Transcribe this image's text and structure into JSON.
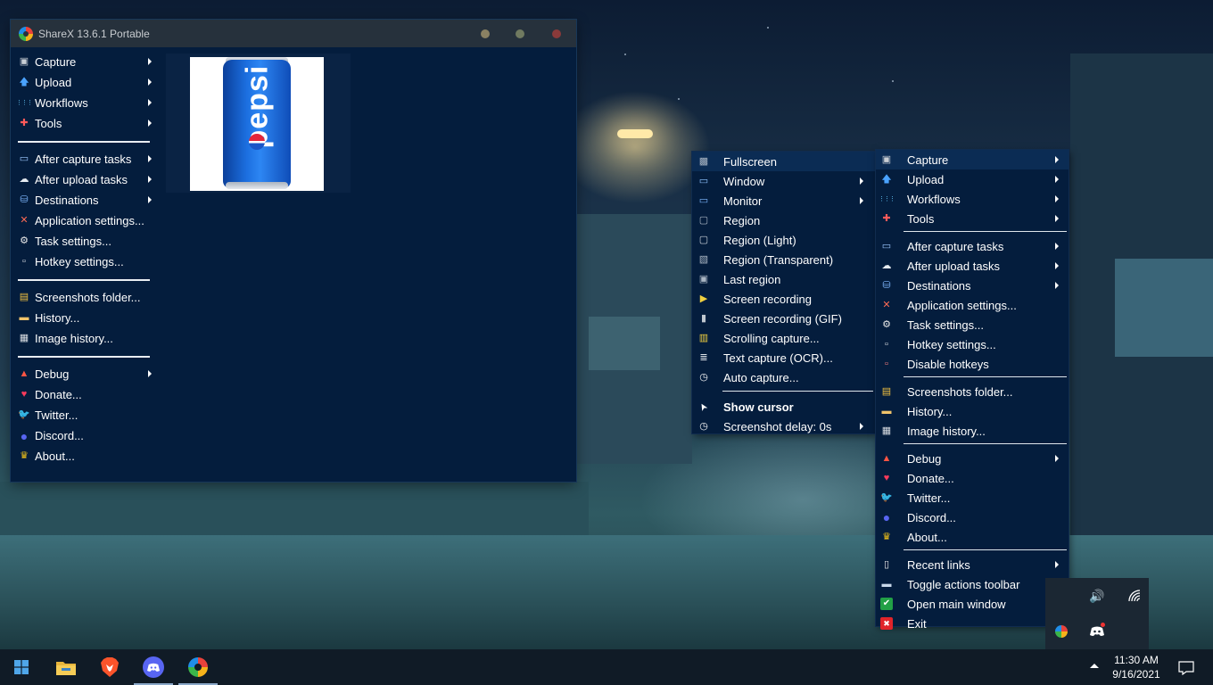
{
  "window": {
    "title": "ShareX 13.6.1 Portable",
    "side_menu": [
      {
        "label": "Capture",
        "icon": "capture-icon",
        "submenu": true
      },
      {
        "label": "Upload",
        "icon": "upload-icon",
        "submenu": true
      },
      {
        "label": "Workflows",
        "icon": "workflows-icon",
        "submenu": true
      },
      {
        "label": "Tools",
        "icon": "tools-icon",
        "submenu": true
      },
      {
        "sep": true
      },
      {
        "label": "After capture tasks",
        "icon": "after-capture-icon",
        "submenu": true
      },
      {
        "label": "After upload tasks",
        "icon": "after-upload-icon",
        "submenu": true
      },
      {
        "label": "Destinations",
        "icon": "destinations-icon",
        "submenu": true
      },
      {
        "label": "Application settings...",
        "icon": "app-settings-icon",
        "submenu": false
      },
      {
        "label": "Task settings...",
        "icon": "gear-icon",
        "submenu": false
      },
      {
        "label": "Hotkey settings...",
        "icon": "hotkey-icon",
        "submenu": false
      },
      {
        "sep": true
      },
      {
        "label": "Screenshots folder...",
        "icon": "folder-icon",
        "submenu": false
      },
      {
        "label": "History...",
        "icon": "history-icon",
        "submenu": false
      },
      {
        "label": "Image history...",
        "icon": "image-history-icon",
        "submenu": false
      },
      {
        "sep": true
      },
      {
        "label": "Debug",
        "icon": "debug-icon",
        "submenu": true
      },
      {
        "label": "Donate...",
        "icon": "heart-icon",
        "submenu": false
      },
      {
        "label": "Twitter...",
        "icon": "twitter-icon",
        "submenu": false
      },
      {
        "label": "Discord...",
        "icon": "discord-icon",
        "submenu": false
      },
      {
        "label": "About...",
        "icon": "crown-icon",
        "submenu": false
      }
    ],
    "preview": {
      "text": "pepsi"
    }
  },
  "capture_submenu": [
    {
      "label": "Fullscreen",
      "icon": "fullscreen-icon",
      "submenu": false,
      "highlight": true
    },
    {
      "label": "Window",
      "icon": "window-icon",
      "submenu": true
    },
    {
      "label": "Monitor",
      "icon": "monitor-icon",
      "submenu": true
    },
    {
      "label": "Region",
      "icon": "region-icon",
      "submenu": false
    },
    {
      "label": "Region (Light)",
      "icon": "region-light-icon",
      "submenu": false
    },
    {
      "label": "Region (Transparent)",
      "icon": "region-transparent-icon",
      "submenu": false
    },
    {
      "label": "Last region",
      "icon": "last-region-icon",
      "submenu": false
    },
    {
      "label": "Screen recording",
      "icon": "screen-recording-icon",
      "submenu": false
    },
    {
      "label": "Screen recording (GIF)",
      "icon": "gif-recording-icon",
      "submenu": false
    },
    {
      "label": "Scrolling capture...",
      "icon": "scrolling-capture-icon",
      "submenu": false
    },
    {
      "label": "Text capture (OCR)...",
      "icon": "ocr-icon",
      "submenu": false
    },
    {
      "label": "Auto capture...",
      "icon": "clock-icon",
      "submenu": false
    },
    {
      "sep": true
    },
    {
      "label": "Show cursor",
      "icon": "cursor-icon",
      "submenu": false,
      "bold": true
    },
    {
      "label": "Screenshot delay: 0s",
      "icon": "clock-icon",
      "submenu": true
    }
  ],
  "tray_menu": [
    {
      "label": "Capture",
      "icon": "capture-icon",
      "submenu": true,
      "highlight": true
    },
    {
      "label": "Upload",
      "icon": "upload-icon",
      "submenu": true
    },
    {
      "label": "Workflows",
      "icon": "workflows-icon",
      "submenu": true
    },
    {
      "label": "Tools",
      "icon": "tools-icon",
      "submenu": true
    },
    {
      "sep": true
    },
    {
      "label": "After capture tasks",
      "icon": "after-capture-icon",
      "submenu": true
    },
    {
      "label": "After upload tasks",
      "icon": "after-upload-icon",
      "submenu": true
    },
    {
      "label": "Destinations",
      "icon": "destinations-icon",
      "submenu": true
    },
    {
      "label": "Application settings...",
      "icon": "app-settings-icon",
      "submenu": false
    },
    {
      "label": "Task settings...",
      "icon": "gear-icon",
      "submenu": false
    },
    {
      "label": "Hotkey settings...",
      "icon": "hotkey-icon",
      "submenu": false
    },
    {
      "label": "Disable hotkeys",
      "icon": "disable-hotkeys-icon",
      "submenu": false
    },
    {
      "sep": true
    },
    {
      "label": "Screenshots folder...",
      "icon": "folder-icon",
      "submenu": false
    },
    {
      "label": "History...",
      "icon": "history-icon",
      "submenu": false
    },
    {
      "label": "Image history...",
      "icon": "image-history-icon",
      "submenu": false
    },
    {
      "sep": true
    },
    {
      "label": "Debug",
      "icon": "debug-icon",
      "submenu": true
    },
    {
      "label": "Donate...",
      "icon": "heart-icon",
      "submenu": false
    },
    {
      "label": "Twitter...",
      "icon": "twitter-icon",
      "submenu": false
    },
    {
      "label": "Discord...",
      "icon": "discord-icon",
      "submenu": false
    },
    {
      "label": "About...",
      "icon": "crown-icon",
      "submenu": false
    },
    {
      "sep": true
    },
    {
      "label": "Recent links",
      "icon": "clipboard-icon",
      "submenu": true
    },
    {
      "label": "Toggle actions toolbar",
      "icon": "toolbar-icon",
      "submenu": false
    },
    {
      "label": "Open main window",
      "icon": "check-icon",
      "submenu": false
    },
    {
      "label": "Exit",
      "icon": "exit-icon",
      "submenu": false
    }
  ],
  "tray_overflow": {
    "icons": [
      "volume-icon",
      "network-icon",
      "sharex-tray-icon",
      "discord-tray-icon"
    ]
  },
  "taskbar": {
    "apps": [
      {
        "name": "start-button",
        "icon": "windows-icon"
      },
      {
        "name": "taskbar-file-explorer",
        "icon": "folder-icon"
      },
      {
        "name": "taskbar-brave",
        "icon": "brave-icon"
      },
      {
        "name": "taskbar-discord",
        "icon": "discord-icon",
        "active": true
      },
      {
        "name": "taskbar-sharex",
        "icon": "sharex-icon",
        "active": true
      }
    ],
    "time": "11:30 AM",
    "date": "9/16/2021"
  },
  "colors": {
    "menu_bg": "#041d3d",
    "titlebar": "#26313c",
    "taskbar": "#101b26",
    "highlight": "#0b2c54"
  }
}
